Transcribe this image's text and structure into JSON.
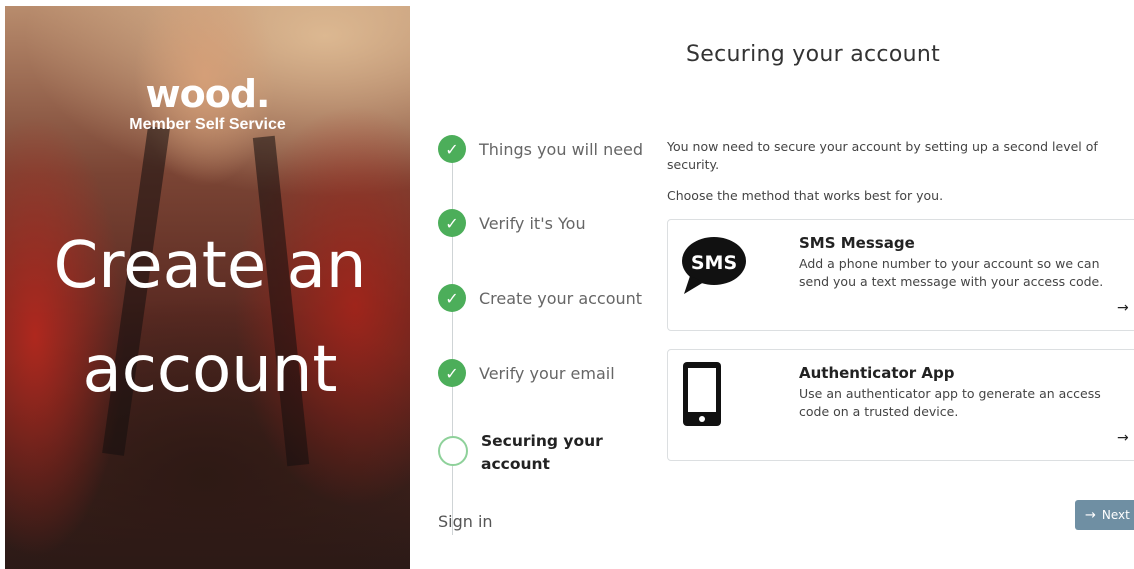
{
  "brand": {
    "logo": "wood.",
    "subtitle": "Member Self Service"
  },
  "hero": {
    "title_line1": "Create an",
    "title_line2": "account"
  },
  "page": {
    "title": "Securing your account"
  },
  "stepper": {
    "steps": [
      {
        "label": "Things you will need",
        "status": "complete"
      },
      {
        "label": "Verify it's You",
        "status": "complete"
      },
      {
        "label": "Create your account",
        "status": "complete"
      },
      {
        "label": "Verify your email",
        "status": "complete"
      },
      {
        "label": "Securing your account",
        "status": "current"
      }
    ],
    "footer": "Sign in"
  },
  "content": {
    "intro": "You now need to secure your account by setting up a second level of security.",
    "choose": "Choose the method that works best for you.",
    "methods": [
      {
        "icon": "sms-bubble-icon",
        "icon_text": "SMS",
        "title": "SMS Message",
        "description": "Add a phone number to your account so we can send you a text message with your access code.",
        "arrow": "→"
      },
      {
        "icon": "smartphone-icon",
        "title": "Authenticator App",
        "description": "Use an authenticator app to generate an access code on a trusted device.",
        "arrow": "→"
      }
    ]
  },
  "actions": {
    "next_arrow": "→",
    "next_label": "Next"
  },
  "colors": {
    "check_green": "#4cae5a",
    "current_ring": "#8ed19a",
    "next_button": "#6f8fa3"
  }
}
